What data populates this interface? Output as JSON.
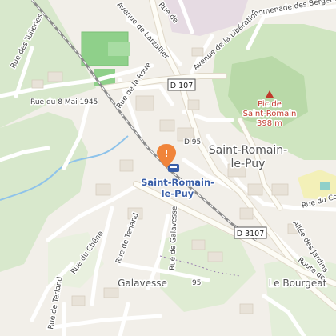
{
  "map": {
    "place_main": [
      "Saint-Romain-",
      "le-Puy"
    ],
    "station": [
      "Saint-Romain-",
      "le-Puy"
    ],
    "peak": {
      "name": [
        "Pic de",
        "Saint-Romain"
      ],
      "elevation": "398 m"
    },
    "places": {
      "galavesse": "Galavesse",
      "bourgeat": "Le Bourgeat"
    },
    "road_shields": {
      "d107": "D 107",
      "d3107": "D 3107"
    },
    "route_labels": {
      "d95": "D 95",
      "n95": "95"
    },
    "streets": {
      "tuileries": "Rue des Tuileries",
      "larzallier": "Avenue de Larzallier",
      "bergeries": "Promenade des Bergeries",
      "liberation": "Avenue de la Libération",
      "rue_de": "Rue de",
      "roue": "Rue de la Roue",
      "mai": "Rue du 8 Mai 1945",
      "chene": "Rue du Chêne",
      "terland": "Rue de Terland",
      "galavesse": "Rue de Galavesse",
      "co": "Rue du Co",
      "jardins": "Allée des Jardins",
      "route_de": "Route de",
      "terland2": "Rue de Terland"
    },
    "colors": {
      "forest": "#cfe5c0",
      "forest_peak": "#b9d9a8",
      "water": "#8fc3ea",
      "rail": "#8a8a8a",
      "marker": "#f0843a",
      "station": "#3a5fa8",
      "peak_marker": "#c0392b"
    }
  }
}
